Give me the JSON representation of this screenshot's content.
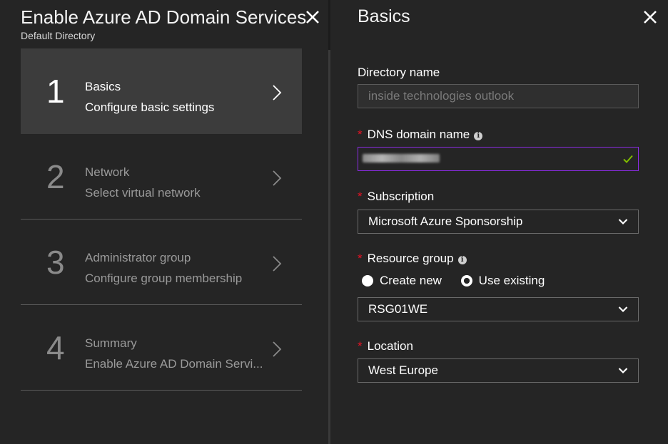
{
  "left_blade": {
    "title": "Enable Azure AD Domain Services",
    "subtitle": "Default Directory",
    "close_icon": "close-icon",
    "steps": [
      {
        "number": "1",
        "title": "Basics",
        "description": "Configure basic settings",
        "active": true
      },
      {
        "number": "2",
        "title": "Network",
        "description": "Select virtual network",
        "active": false
      },
      {
        "number": "3",
        "title": "Administrator group",
        "description": "Configure group membership",
        "active": false
      },
      {
        "number": "4",
        "title": "Summary",
        "description": "Enable Azure AD Domain Servi...",
        "active": false
      }
    ]
  },
  "right_blade": {
    "title": "Basics",
    "close_icon": "close-icon",
    "directory_name": {
      "label": "Directory name",
      "value": "inside technologies outlook"
    },
    "dns_domain_name": {
      "label": "DNS domain name",
      "value": "",
      "required_marker": "*",
      "info_icon": "info-icon",
      "valid_icon": "checkmark-icon"
    },
    "subscription": {
      "label": "Subscription",
      "value": "Microsoft Azure Sponsorship",
      "required_marker": "*"
    },
    "resource_group": {
      "label": "Resource group",
      "required_marker": "*",
      "info_icon": "info-icon",
      "options": [
        {
          "label": "Create new",
          "selected": false
        },
        {
          "label": "Use existing",
          "selected": true
        }
      ],
      "value": "RSG01WE"
    },
    "location": {
      "label": "Location",
      "value": "West Europe",
      "required_marker": "*"
    }
  },
  "colors": {
    "background": "#252525",
    "active_step": "#3c3c3c",
    "required": "#e81123",
    "valid_check": "#7fba00",
    "valid_border": "#8a2be2"
  }
}
